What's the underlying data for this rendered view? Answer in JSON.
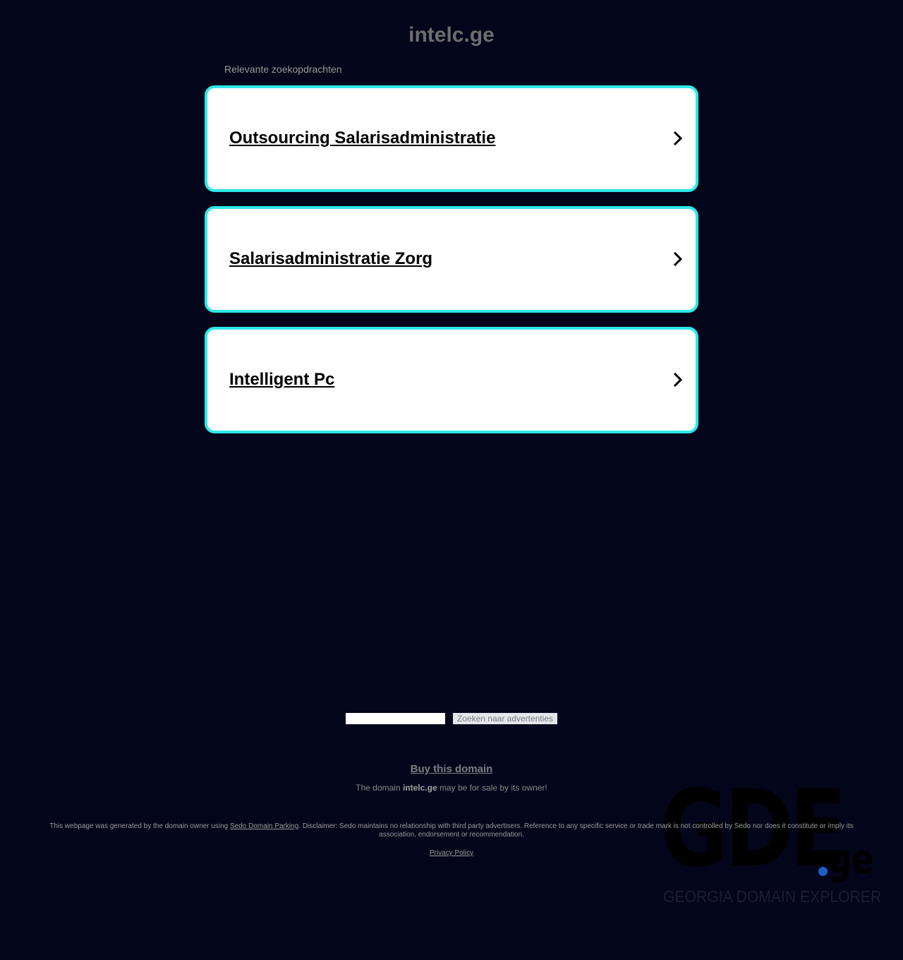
{
  "header": {
    "title": "intelc.ge"
  },
  "related": {
    "label": "Relevante zoekopdrachten",
    "items": [
      {
        "label": "Outsourcing Salarisadministratie"
      },
      {
        "label": "Salarisadministratie Zorg"
      },
      {
        "label": "Intelligent Pc"
      }
    ]
  },
  "search": {
    "input_value": "",
    "button_label": "Zoeken naar advertenties"
  },
  "sale": {
    "buy_label": "Buy this domain",
    "prefix": "The domain ",
    "domain": "intelc.ge",
    "suffix": " may be for sale by its owner!"
  },
  "footer": {
    "disclaimer_prefix": "This webpage was generated by the domain owner using ",
    "sedo_link": "Sedo Domain Parking",
    "disclaimer_suffix": ". Disclaimer: Sedo maintains no relationship with third party advertisers. Reference to any specific service or trade mark is not controlled by Sedo nor does it constitute or imply its association, endorsement or recommendation.",
    "privacy_label": "Privacy Policy"
  },
  "logo": {
    "main": "GDE",
    "tld": "ge",
    "tagline": "GEORGIA DOMAIN EXPLORER"
  },
  "colors": {
    "background": "#03051a",
    "card_border": "#2de8e8",
    "logo_dot": "#1d5fc6"
  },
  "icons": {
    "card_arrow": "chevron-right-icon"
  }
}
